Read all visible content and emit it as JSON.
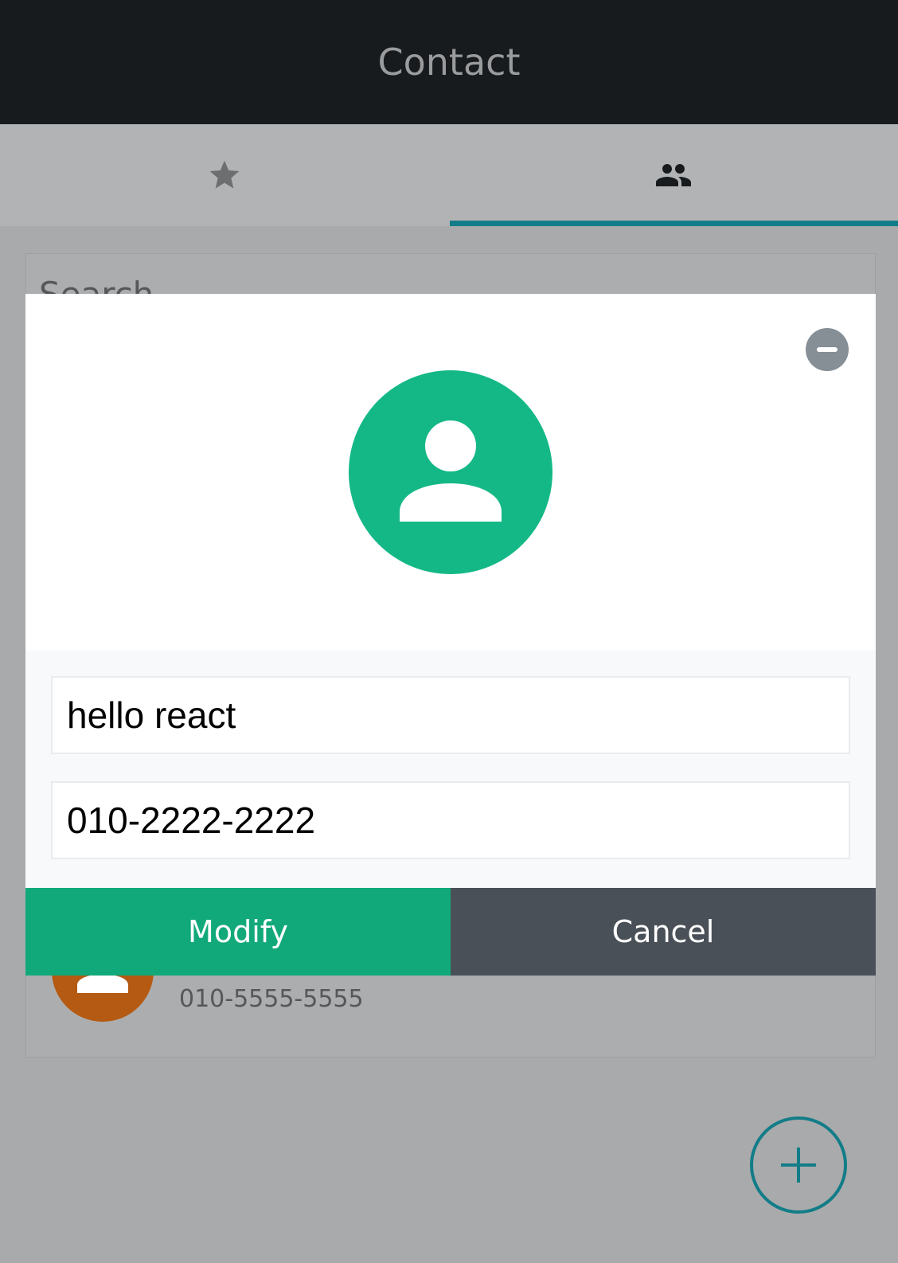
{
  "header": {
    "title": "Contact"
  },
  "tabs": [
    {
      "icon": "star-icon",
      "selected": false
    },
    {
      "icon": "people-icon",
      "selected": true
    }
  ],
  "colors": {
    "header_bg": "#181b1e",
    "accent": "#127d88",
    "modify_button": "#12a97a",
    "cancel_button": "#495057",
    "modal_avatar": "#14b886",
    "list_avatar": "#b55a12"
  },
  "search": {
    "placeholder": "Search"
  },
  "list": {
    "items": [
      {
        "phone": "010-5555-5555",
        "avatar_color": "#b55a12"
      }
    ]
  },
  "modal": {
    "name_value": "hello react",
    "phone_value": "010-2222-2222",
    "modify_label": "Modify",
    "cancel_label": "Cancel"
  }
}
